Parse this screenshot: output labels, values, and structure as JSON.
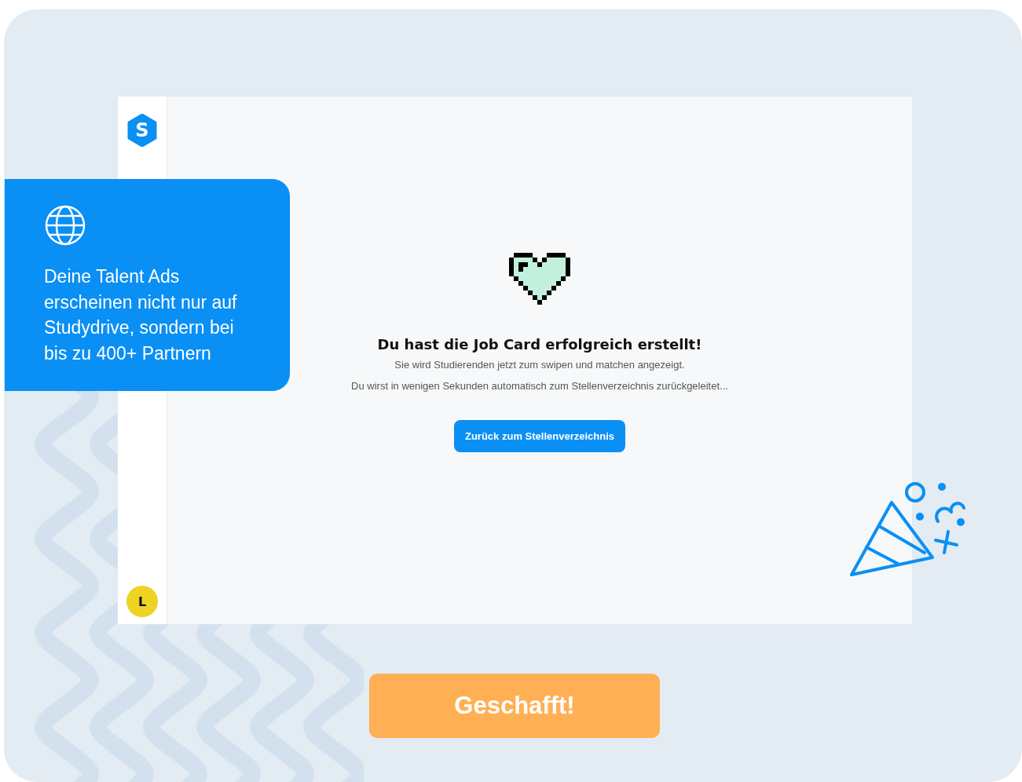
{
  "sidebar": {
    "logo_letter": "S",
    "avatar_letter": "L"
  },
  "callout": {
    "text": "Deine Talent Ads erscheinen nicht nur auf Studydrive, sondern bei bis zu 400+ Partnern"
  },
  "success": {
    "title": "Du hast die Job Card erfolgreich erstellt!",
    "message": "Sie wird Studierenden jetzt zum swipen und matchen angezeigt.",
    "redirect_note": "Du wirst in wenigen Sekunden automatisch zum Stellenverzeichnis zurückgeleitet...",
    "button": "Zurück zum Stellenverzeichnis"
  },
  "cta_button": "Geschafft!"
}
